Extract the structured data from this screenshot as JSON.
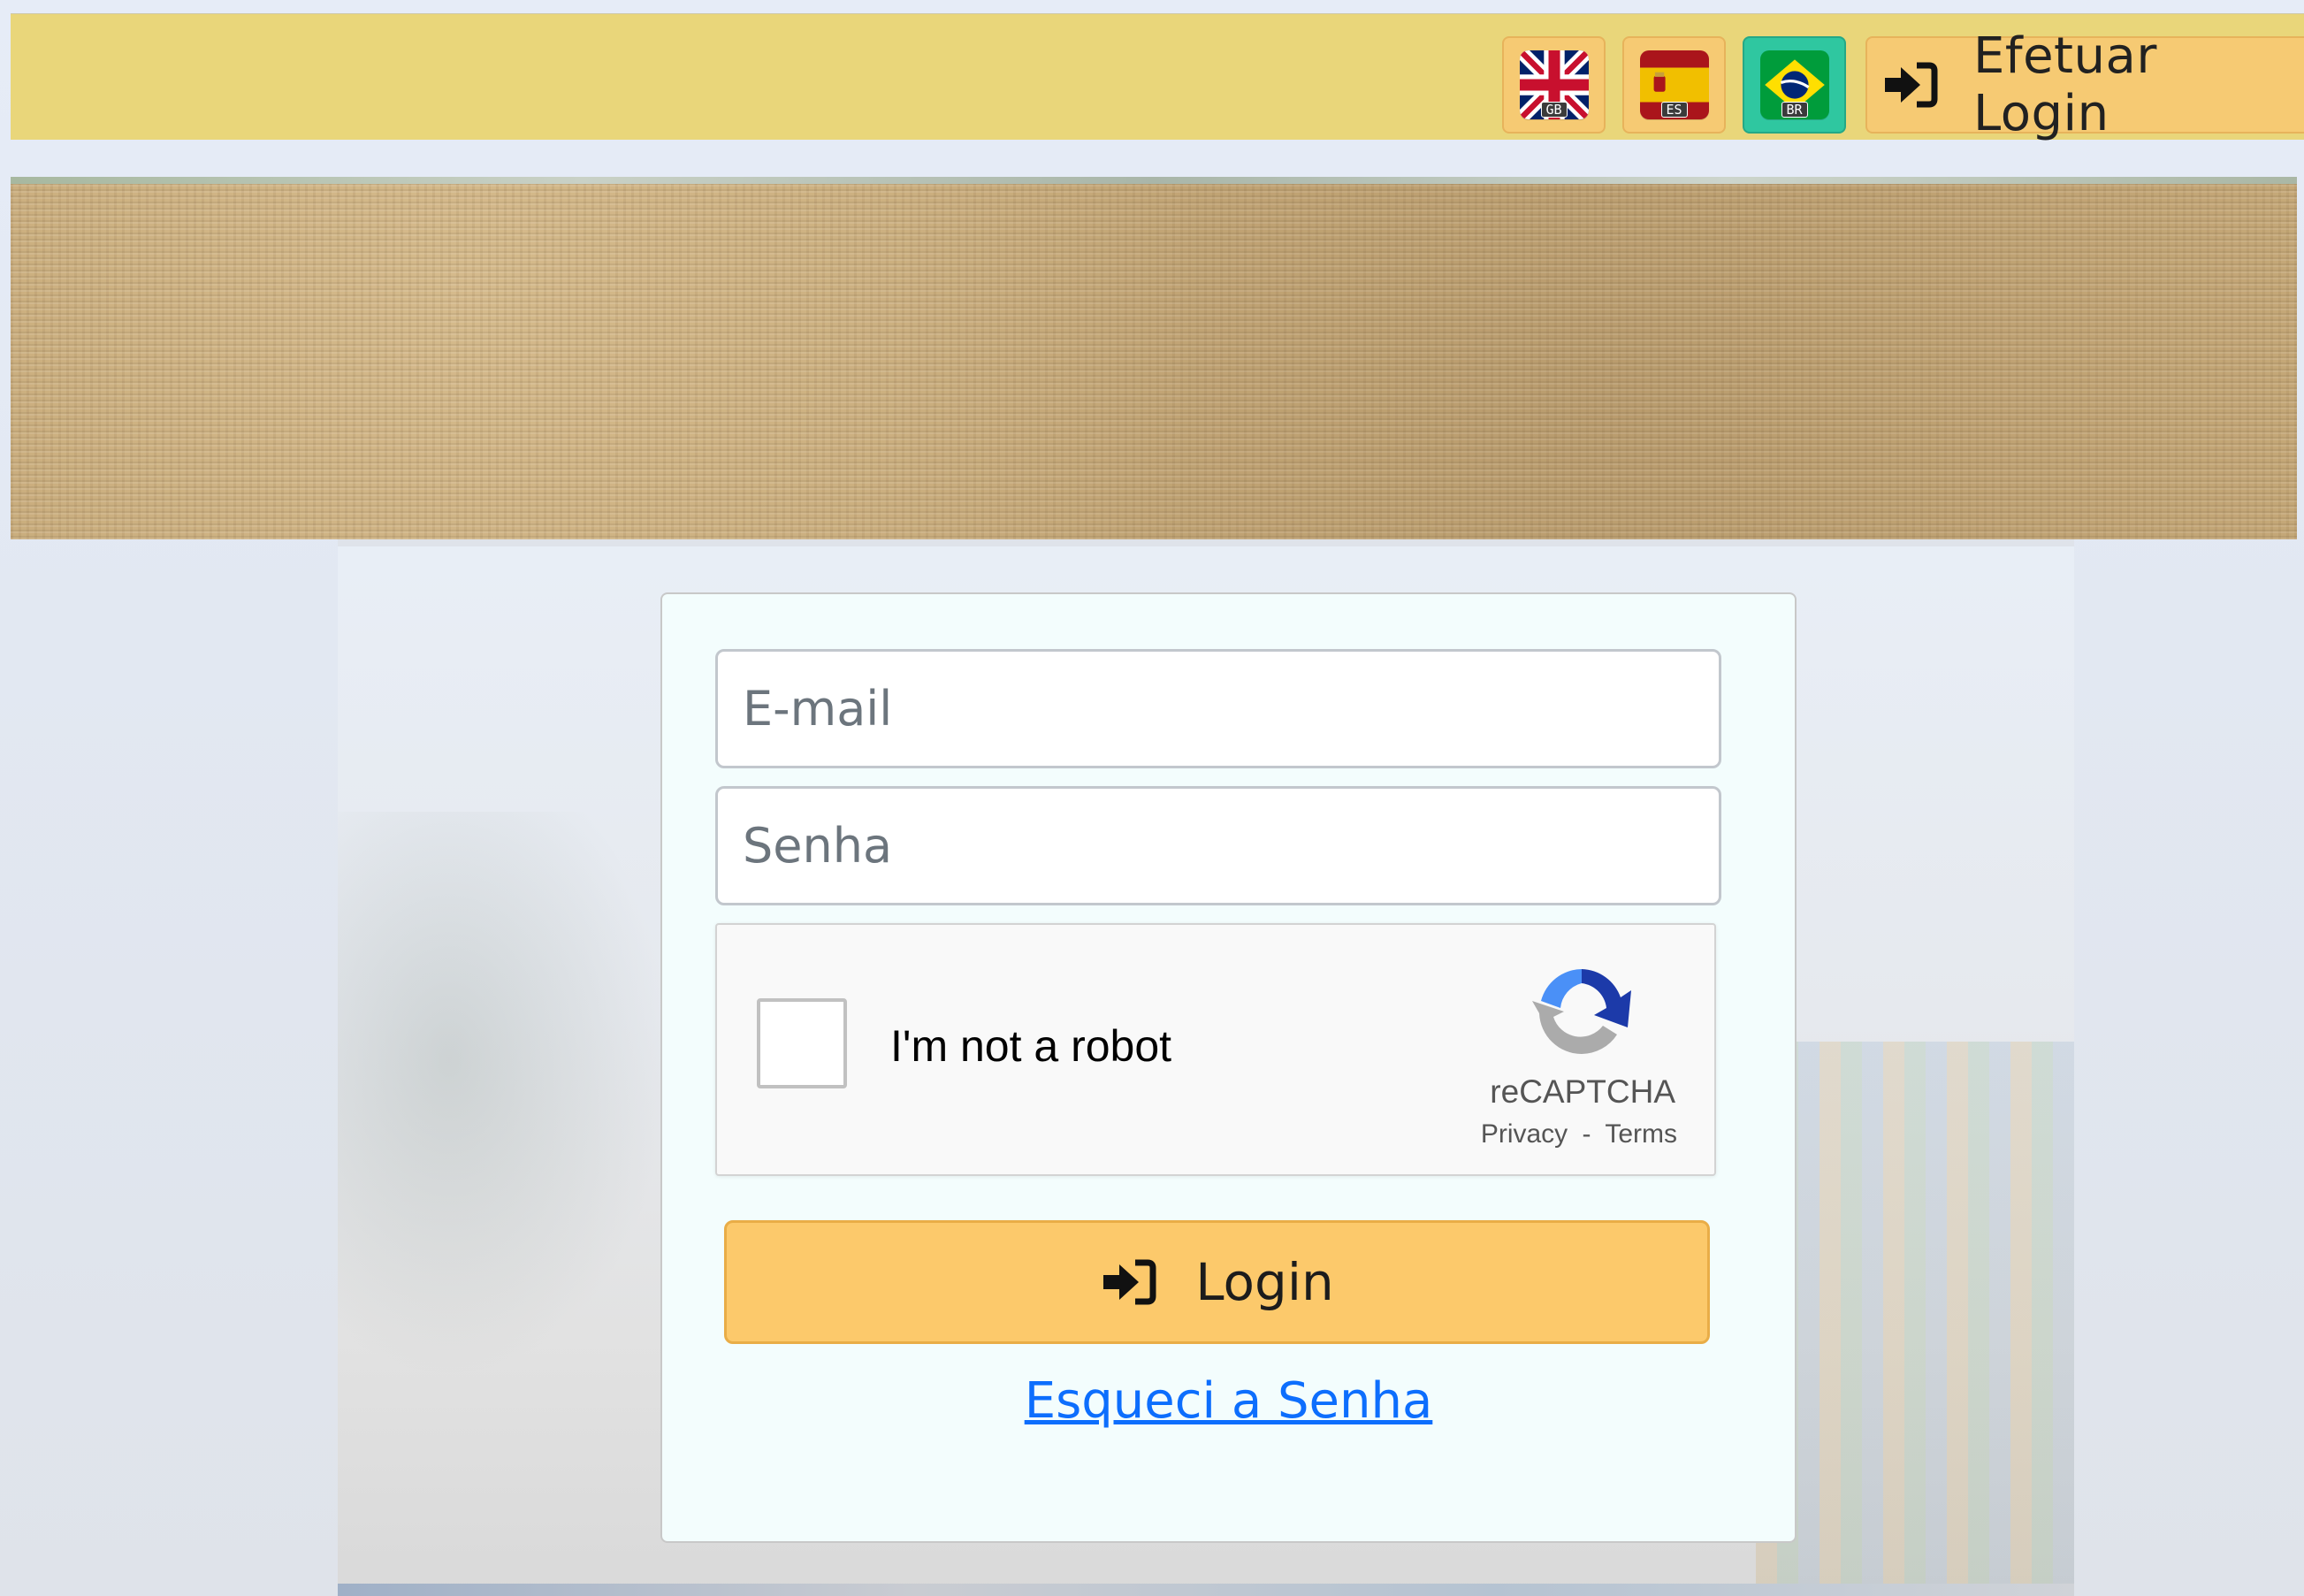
{
  "header": {
    "languages": [
      {
        "code": "GB",
        "icon": "uk-flag-icon"
      },
      {
        "code": "ES",
        "icon": "spain-flag-icon"
      },
      {
        "code": "BR",
        "icon": "brazil-flag-icon",
        "active": true
      }
    ],
    "login_button": {
      "label": "Efetuar Login",
      "icon": "sign-in-icon"
    }
  },
  "login_form": {
    "email": {
      "placeholder": "E-mail",
      "value": ""
    },
    "password": {
      "placeholder": "Senha",
      "value": ""
    },
    "captcha": {
      "label": "I'm not a robot",
      "brand": "reCAPTCHA",
      "privacy": "Privacy",
      "separator": "-",
      "terms": "Terms",
      "icon": "recaptcha-icon"
    },
    "submit": {
      "label": "Login",
      "icon": "sign-in-icon"
    },
    "forgot_password": "Esqueci a Senha"
  },
  "colors": {
    "topbar": "#e9d67a",
    "button": "#fcc96b",
    "active_flag": "#2fc7a0",
    "link": "#0d6efd"
  }
}
